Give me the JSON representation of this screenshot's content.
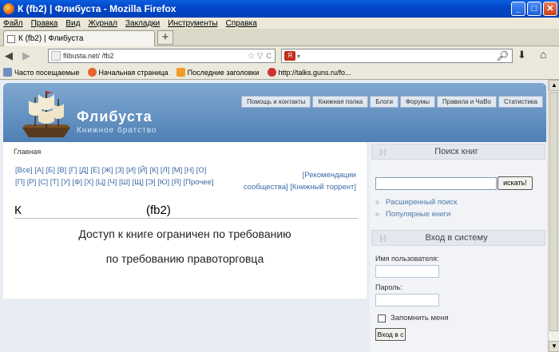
{
  "window": {
    "title": "К                         (fb2) | Флибуста - Mozilla Firefox",
    "min": "_",
    "max": "□",
    "close": "✕"
  },
  "menu": [
    "Файл",
    "Правка",
    "Вид",
    "Журнал",
    "Закладки",
    "Инструменты",
    "Справка"
  ],
  "tab": {
    "label": "К                   (fb2) | Флибуста",
    "new": "+"
  },
  "nav": {
    "url": "flibusta.net/              /fb2",
    "back": "◀",
    "fwd": "▶",
    "reload": "C",
    "search_engine": "Я",
    "download": "⬇",
    "home": "⌂"
  },
  "bookmarks": [
    "Часто посещаемые",
    "Начальная страница",
    "Последние заголовки",
    "http://talks.guns.ru/fo..."
  ],
  "site": {
    "name": "Флибуста",
    "tagline": "Книжное братство",
    "tabs": [
      "Помощь и контакты",
      "Книжная полка",
      "Блоги",
      "Форумы",
      "Правила и ЧаВо",
      "Статистика"
    ]
  },
  "main": {
    "breadcrumb": "Главная",
    "alphabet": "[Все] [А] [Б] [В] [Г] [Д] [Е] [Ж] [З] [И] [Й] [К] [Л] [М] [Н] [О] [П] [Р] [С] [Т] [У] [Ф] [Х] [Ц] [Ч] [Ш] [Щ] [Э] [Ю] [Я] [Прочее]",
    "links_line1": "[Рекомендации",
    "links_line2": "сообщества] [Книжный торрент]",
    "book_title_left": "К",
    "book_title_right": "(fb2)",
    "message1": "Доступ к книге ограничен по требованию",
    "message2": "по требованию правоторговца"
  },
  "sidebar": {
    "search_title": "Поиск книг",
    "search_button": "искать!",
    "advanced": "Расширенный поиск",
    "popular": "Популярные книги",
    "login_title": "Вход в систему",
    "username_label": "Имя пользователя:",
    "password_label": "Пароль:",
    "remember": "Запомнить меня",
    "login_button": "Вход в с",
    "collapse": "[-]"
  }
}
